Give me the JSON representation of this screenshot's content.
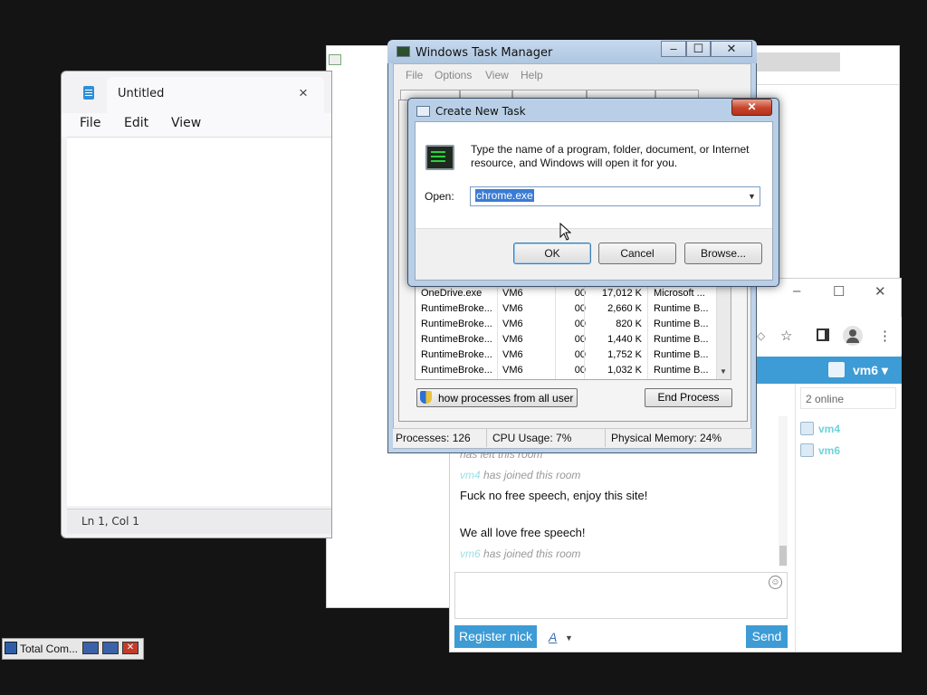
{
  "notepad": {
    "title": "Untitled",
    "close_icon": "×",
    "menu": [
      "File",
      "Edit",
      "View"
    ],
    "status": "Ln 1, Col 1"
  },
  "chat": {
    "window_controls": [
      "–",
      "☐",
      "✕"
    ],
    "username": "vm6",
    "online_count": "2 online",
    "users": [
      "vm4",
      "vm6"
    ],
    "messages": [
      {
        "type": "system",
        "nick": "",
        "text": "has left this room"
      },
      {
        "type": "system",
        "nick": "vm4",
        "text": "has joined this room"
      },
      {
        "type": "message",
        "text": "Fuck no free speech, enjoy this site!"
      },
      {
        "type": "message",
        "text": "We all love free speech!"
      },
      {
        "type": "system",
        "nick": "vm6",
        "text": "has joined this room"
      }
    ],
    "register_label": "Register nick",
    "font_label": "A",
    "send_label": "Send"
  },
  "task_manager": {
    "title": "Windows Task Manager",
    "title_controls": [
      "‒",
      "☐",
      "✕"
    ],
    "menu": [
      "File",
      "Options",
      "View",
      "Help"
    ],
    "processes": [
      {
        "name": "OneDrive.exe",
        "user": "VM6",
        "cpu": "00",
        "mem": "17,012 K",
        "desc": "Microsoft ..."
      },
      {
        "name": "RuntimeBroke...",
        "user": "VM6",
        "cpu": "00",
        "mem": "2,660 K",
        "desc": "Runtime B..."
      },
      {
        "name": "RuntimeBroke...",
        "user": "VM6",
        "cpu": "00",
        "mem": "820 K",
        "desc": "Runtime B..."
      },
      {
        "name": "RuntimeBroke...",
        "user": "VM6",
        "cpu": "00",
        "mem": "1,440 K",
        "desc": "Runtime B..."
      },
      {
        "name": "RuntimeBroke...",
        "user": "VM6",
        "cpu": "00",
        "mem": "1,752 K",
        "desc": "Runtime B..."
      },
      {
        "name": "RuntimeBroke...",
        "user": "VM6",
        "cpu": "00",
        "mem": "1,032 K",
        "desc": "Runtime B..."
      }
    ],
    "show_all_label": "how processes from all user",
    "end_process_label": "End Process",
    "status": {
      "processes": "Processes: 126",
      "cpu": "CPU Usage: 7%",
      "memory": "Physical Memory: 24%"
    }
  },
  "dialog": {
    "title": "Create New Task",
    "close_label": "✕",
    "description": "Type the name of a program, folder, document, or Internet resource, and Windows will open it for you.",
    "open_label": "Open:",
    "open_value": "chrome.exe",
    "ok_label": "OK",
    "cancel_label": "Cancel",
    "browse_label": "Browse..."
  },
  "taskbar": {
    "label": "Total Com..."
  },
  "colors": {
    "chat_accent": "#3d9bd5",
    "nick_color": "#6fd3d8",
    "selection": "#3a7bd5",
    "close_red": "#c7442a"
  }
}
